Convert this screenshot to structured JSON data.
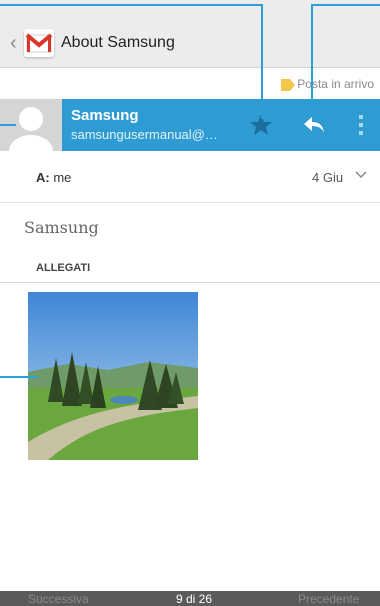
{
  "action_bar": {
    "title": "About Samsung",
    "app_icon": "gmail-icon",
    "up_icon": "chevron-left-icon"
  },
  "label_row": {
    "label": "Posta in arrivo",
    "label_color": "#f2c94c"
  },
  "sender": {
    "name": "Samsung",
    "email": "samsungusermanual@…",
    "bar_color": "#2f9bd3",
    "star_icon": "star-icon",
    "reply_icon": "reply-icon",
    "menu_icon": "overflow-menu-icon"
  },
  "recipient": {
    "prefix": "A:",
    "value": "me",
    "date": "4 Giu",
    "expand_icon": "chevron-down-icon"
  },
  "message": {
    "body": "Samsung",
    "attachments_header": "ALLEGATI",
    "attachment_icon": "image-thumbnail"
  },
  "bottom_nav": {
    "next": "Successiva",
    "count": "9 di 26",
    "prev": "Precedente"
  },
  "colors": {
    "callout": "#2a9fd8"
  }
}
